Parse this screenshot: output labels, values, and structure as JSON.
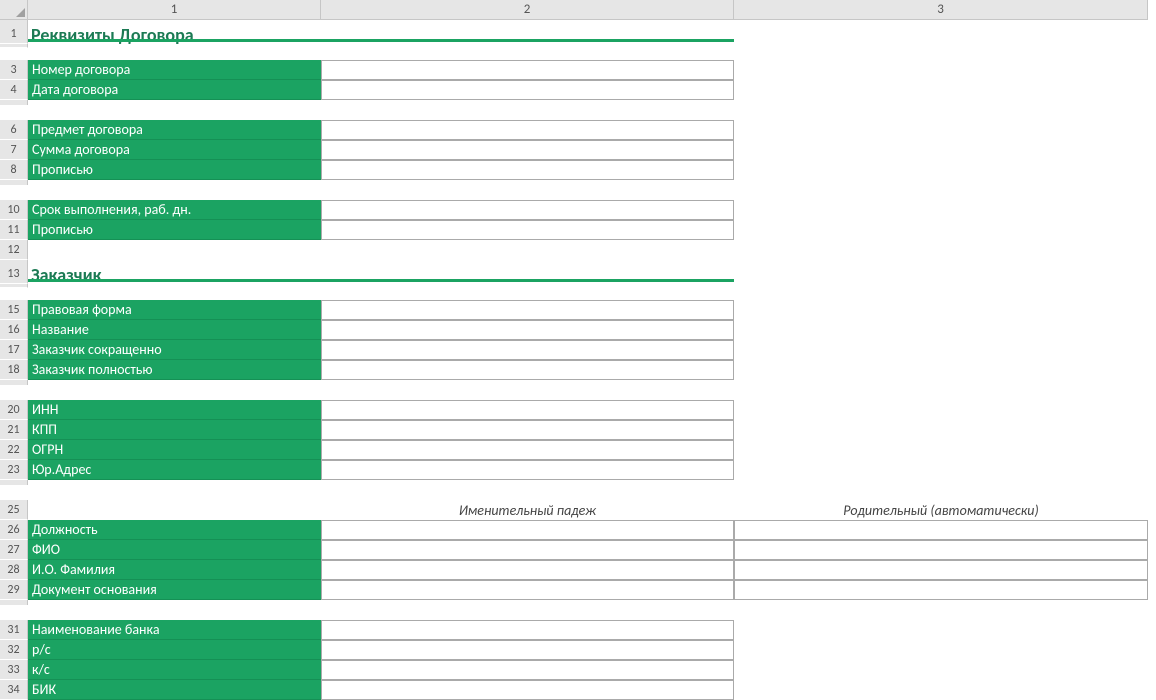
{
  "columns": [
    "1",
    "2",
    "3"
  ],
  "rows": {
    "r1": "1",
    "r3": "3",
    "r4": "4",
    "r6": "6",
    "r7": "7",
    "r8": "8",
    "r10": "10",
    "r11": "11",
    "r12": "12",
    "r13": "13",
    "r15": "15",
    "r16": "16",
    "r17": "17",
    "r18": "18",
    "r20": "20",
    "r21": "21",
    "r22": "22",
    "r23": "23",
    "r25": "25",
    "r26": "26",
    "r27": "27",
    "r28": "28",
    "r29": "29",
    "r31": "31",
    "r32": "32",
    "r33": "33",
    "r34": "34"
  },
  "section1_title": "Реквизиты Договора",
  "labels": {
    "contract_no": "Номер договора",
    "contract_date": "Дата договора",
    "subject": "Предмет договора",
    "amount": "Сумма договора",
    "amount_words": "Прописью",
    "deadline": "Срок выполнения, раб. дн.",
    "deadline_words": "Прописью"
  },
  "section2_title": "Заказчик",
  "customer": {
    "legal_form": "Правовая форма",
    "name": "Название",
    "short": "Заказчик сокращенно",
    "full": "Заказчик полностью",
    "inn": "ИНН",
    "kpp": "КПП",
    "ogrn": "ОГРН",
    "addr": "Юр.Адрес",
    "position": "Должность",
    "fio": "ФИО",
    "io_surname": "И.О. Фамилия",
    "basis_doc": "Документ основания",
    "bank_name": "Наименование банка",
    "acct": "р/с",
    "corr_acct": "к/с",
    "bik": "БИК"
  },
  "case_headers": {
    "nominative": "Именительный падеж",
    "genitive": "Родительный (автоматически)"
  }
}
